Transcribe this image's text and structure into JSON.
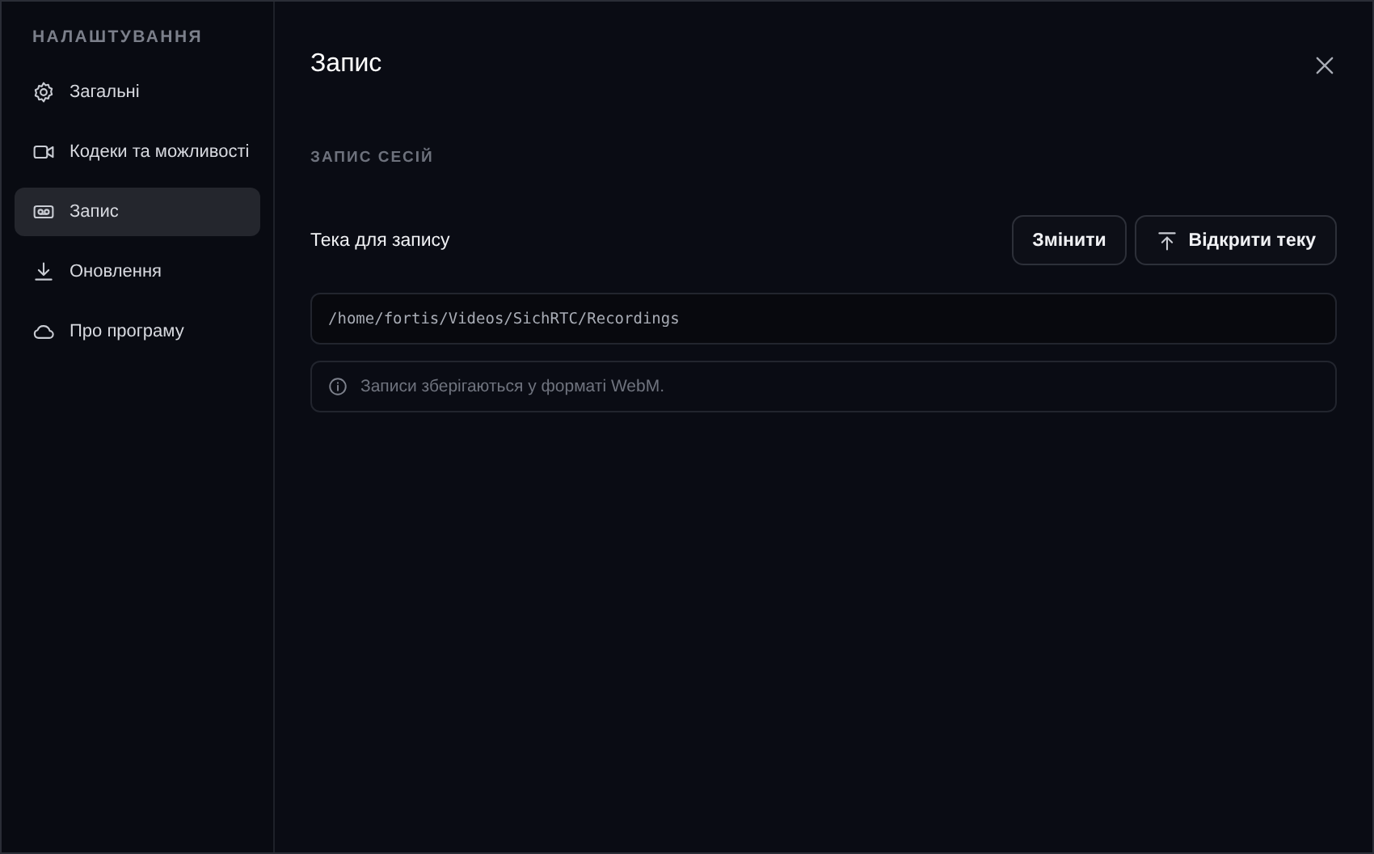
{
  "sidebar": {
    "heading": "НАЛАШТУВАННЯ",
    "items": [
      {
        "label": "Загальні",
        "selected": false
      },
      {
        "label": "Кодеки та можливості",
        "selected": false
      },
      {
        "label": "Запис",
        "selected": true
      },
      {
        "label": "Оновлення",
        "selected": false
      },
      {
        "label": "Про програму",
        "selected": false
      }
    ]
  },
  "panel": {
    "title": "Запис",
    "section": "ЗАПИС СЕСІЙ",
    "folder_label": "Тека для запису",
    "buttons": [
      {
        "label": "Змінити"
      },
      {
        "label": "Відкрити теку"
      }
    ],
    "path": "/home/fortis/Videos/SichRTC/Recordings",
    "note": "Записи зберігаються у форматі WebM."
  }
}
